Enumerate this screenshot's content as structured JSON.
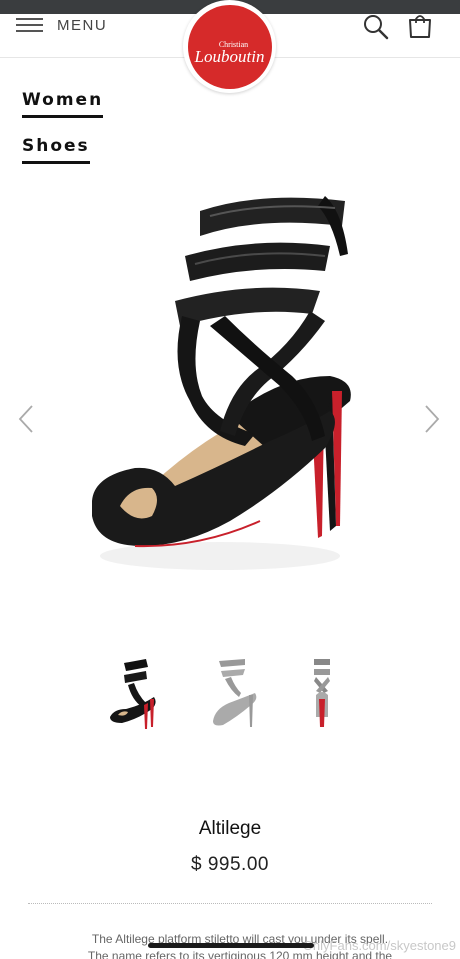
{
  "header": {
    "menu_label": "MENU",
    "logo_text_small": "Christian",
    "logo_text_main": "Louboutin"
  },
  "breadcrumbs": [
    {
      "label": "Women"
    },
    {
      "label": "Shoes"
    }
  ],
  "product": {
    "name": "Altilege",
    "price": "$ 995.00",
    "description_lines": [
      "The Altilege platform stiletto will cast you under its spell.",
      "The name refers to its vertiginous 120 mm height and the"
    ]
  },
  "gallery": {
    "thumbnails": [
      "side view",
      "outline view",
      "back view"
    ],
    "active_index": 0
  },
  "watermark": "OnlyFans.com/skyestone9",
  "colors": {
    "accent_red": "#d62a2a",
    "sole_red": "#c8202b",
    "text": "#111111",
    "muted": "#666666",
    "status_bar": "#3a3d3f"
  }
}
